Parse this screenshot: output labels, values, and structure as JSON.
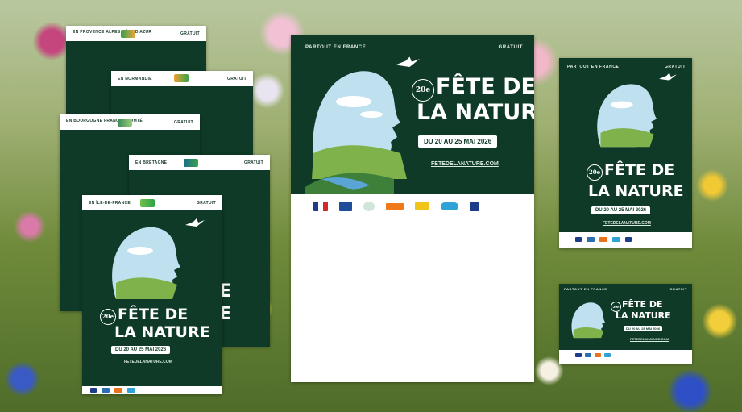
{
  "event": {
    "title_line1": "FÊTE DE",
    "title_line2": "LA NATURE",
    "edition": "20e",
    "dates": "DU 20 AU 25 MAI 2026",
    "url": "FETEDELANATURE.COM",
    "free_label": "GRATUIT",
    "everywhere_label": "PARTOUT EN FRANCE"
  },
  "regional_posters": [
    {
      "region": "EN PROVENCE ALPES CÔTE D'AZUR",
      "free": "GRATUIT"
    },
    {
      "region": "EN NORMANDIE",
      "free": "GRATUIT"
    },
    {
      "region": "EN BOURGOGNE FRANCHE-COMTÉ",
      "free": "GRATUIT"
    },
    {
      "region": "EN BRETAGNE",
      "free": "GRATUIT"
    },
    {
      "region": "EN ÎLE-DE-FRANCE",
      "free": "GRATUIT"
    }
  ],
  "partner_logos": [
    "République Française",
    "OFB",
    "EDF",
    "Michelin"
  ],
  "colors": {
    "poster_green": "#0e3a27",
    "sky": "#bfe0ef",
    "grass": "#7fb24a"
  }
}
